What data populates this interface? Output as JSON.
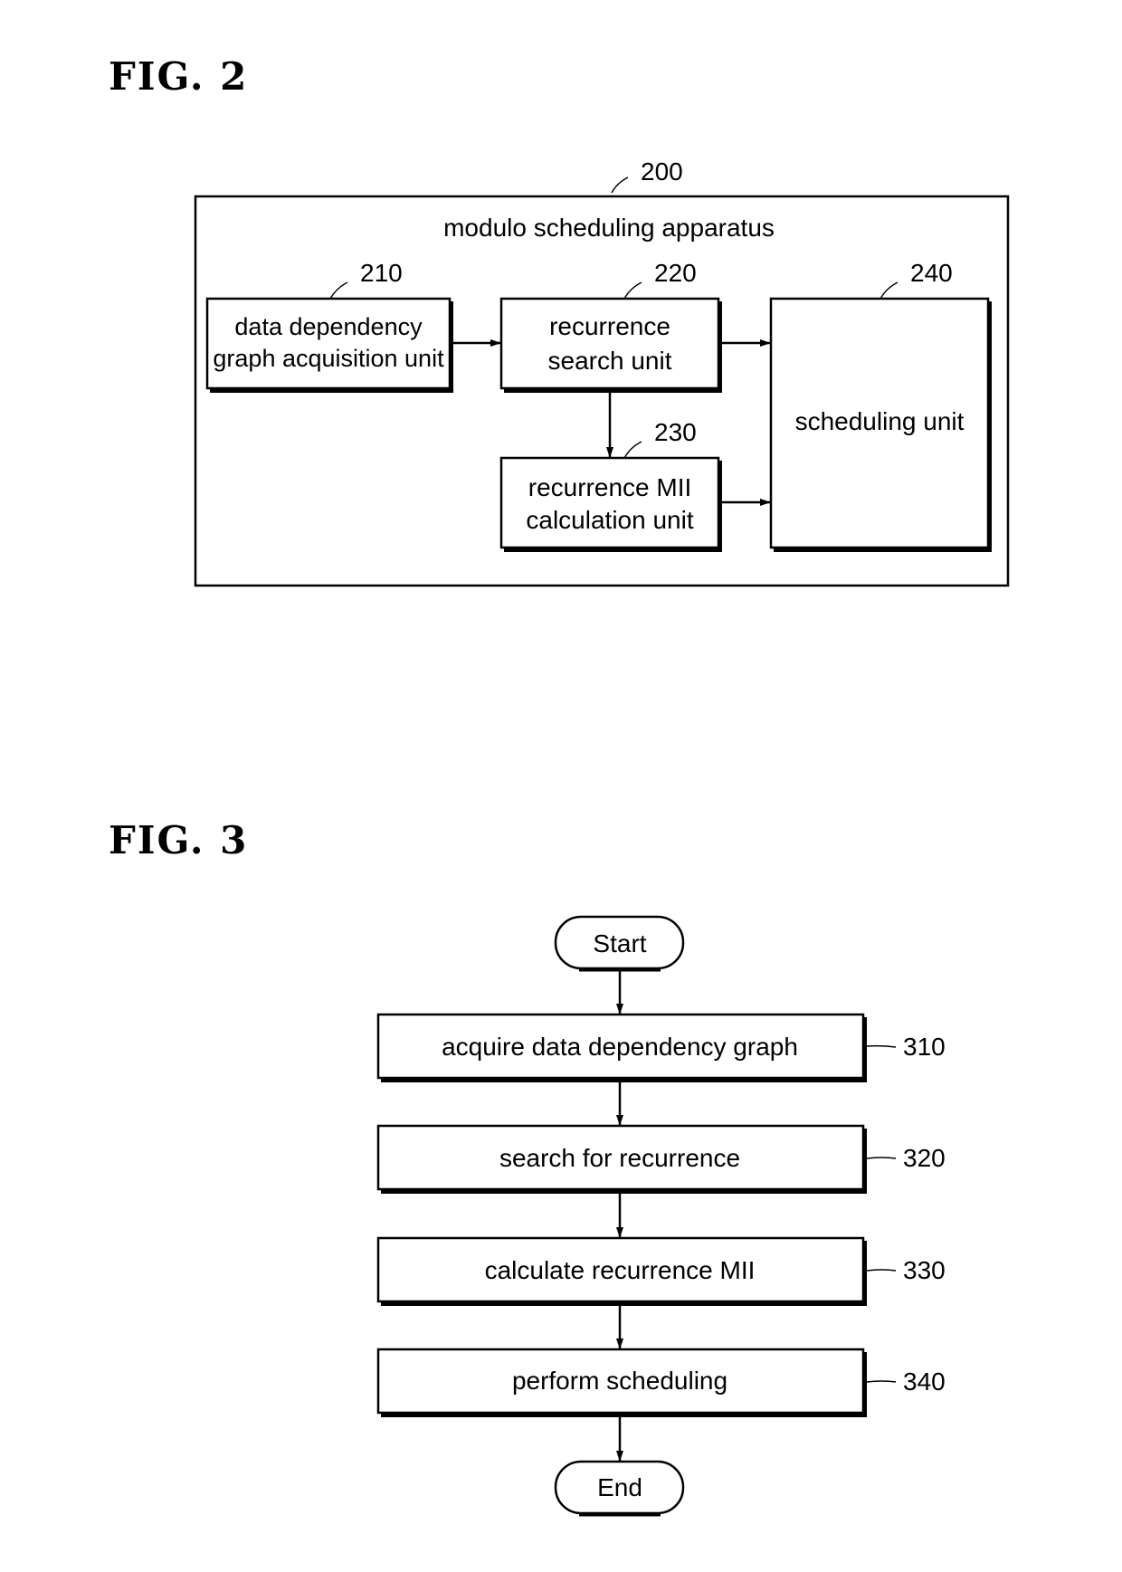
{
  "figures": [
    {
      "label": "FIG.  2",
      "apparatus": {
        "ref": "200",
        "title": "modulo scheduling apparatus"
      },
      "units": [
        {
          "ref": "210",
          "lines": [
            "data dependency",
            "graph acquisition unit"
          ]
        },
        {
          "ref": "220",
          "lines": [
            "recurrence",
            "search unit"
          ]
        },
        {
          "ref": "230",
          "lines": [
            "recurrence MII",
            "calculation unit"
          ]
        },
        {
          "ref": "240",
          "lines": [
            "scheduling unit"
          ]
        }
      ]
    },
    {
      "label": "FIG.  3",
      "start": "Start",
      "end": "End",
      "steps": [
        {
          "ref": "310",
          "label": "acquire data dependency graph"
        },
        {
          "ref": "320",
          "label": "search for recurrence"
        },
        {
          "ref": "330",
          "label": "calculate recurrence MII"
        },
        {
          "ref": "340",
          "label": "perform scheduling"
        }
      ]
    }
  ]
}
